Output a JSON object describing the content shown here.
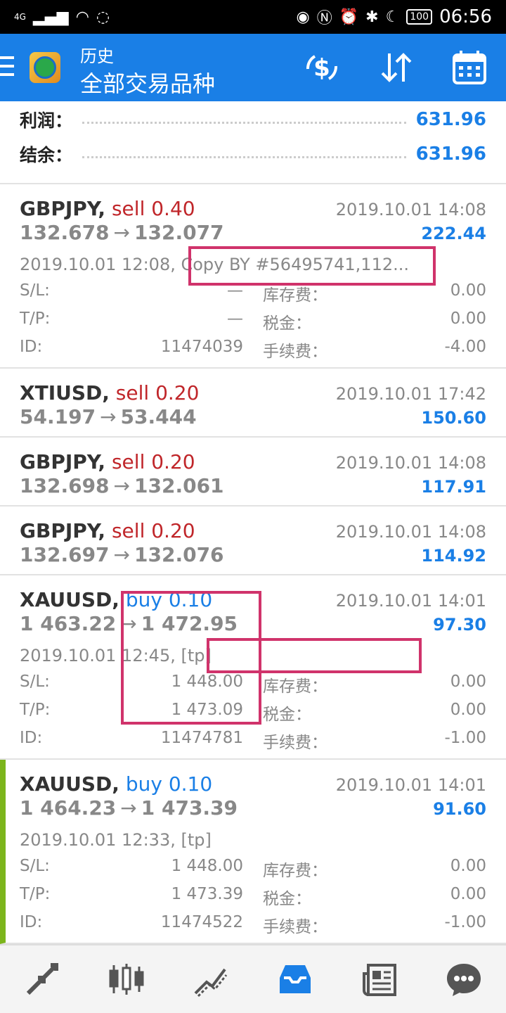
{
  "status_bar": {
    "network": "4G",
    "battery": "100",
    "time": "06:56"
  },
  "app_bar": {
    "subtitle": "历史",
    "title": "全部交易品种"
  },
  "summary": {
    "profit_label": "利润：",
    "profit_value": "631.96",
    "balance_label": "结余：",
    "balance_value": "631.96"
  },
  "detail_labels": {
    "sl": "S/L:",
    "tp": "T/P:",
    "id": "ID:",
    "swap": "库存费：",
    "tax": "税金：",
    "fee": "手续费："
  },
  "trades": [
    {
      "symbol": "GBPJPY,",
      "side": "sell 0.40",
      "time": "2019.10.01 14:08",
      "open": "132.678",
      "arrow": "→",
      "close": "132.077",
      "profit": "222.44",
      "comment": "2019.10.01 12:08, Copy BY #56495741,112...",
      "sl": "—",
      "tp": "—",
      "id": "11474039",
      "swap": "0.00",
      "tax": "0.00",
      "fee": "-4.00"
    },
    {
      "symbol": "XTIUSD,",
      "side": "sell 0.20",
      "time": "2019.10.01 17:42",
      "open": "54.197",
      "arrow": "→",
      "close": "53.444",
      "profit": "150.60"
    },
    {
      "symbol": "GBPJPY,",
      "side": "sell 0.20",
      "time": "2019.10.01 14:08",
      "open": "132.698",
      "arrow": "→",
      "close": "132.061",
      "profit": "117.91"
    },
    {
      "symbol": "GBPJPY,",
      "side": "sell 0.20",
      "time": "2019.10.01 14:08",
      "open": "132.697",
      "arrow": "→",
      "close": "132.076",
      "profit": "114.92"
    },
    {
      "symbol": "XAUUSD,",
      "side": "buy 0.10",
      "time": "2019.10.01 14:01",
      "open": "1 463.22",
      "arrow": "→",
      "close": "1 472.95",
      "profit": "97.30",
      "comment": "2019.10.01 12:45, [tp]",
      "sl": "1 448.00",
      "tp": "1 473.09",
      "id": "11474781",
      "swap": "0.00",
      "tax": "0.00",
      "fee": "-1.00"
    },
    {
      "symbol": "XAUUSD,",
      "side": "buy 0.10",
      "time": "2019.10.01 14:01",
      "open": "1 464.23",
      "arrow": "→",
      "close": "1 473.39",
      "profit": "91.60",
      "comment": "2019.10.01 12:33, [tp]",
      "sl": "1 448.00",
      "tp": "1 473.39",
      "id": "11474522",
      "swap": "0.00",
      "tax": "0.00",
      "fee": "-1.00"
    }
  ],
  "bottom_nav": [
    "quotes-icon",
    "chart-icon",
    "trade-icon",
    "history-icon",
    "news-icon",
    "chat-icon"
  ],
  "colors": {
    "accent": "#1a7fe6",
    "sell": "#c0262a",
    "highlight": "#d0336b",
    "active_bar": "#7cb51c"
  }
}
